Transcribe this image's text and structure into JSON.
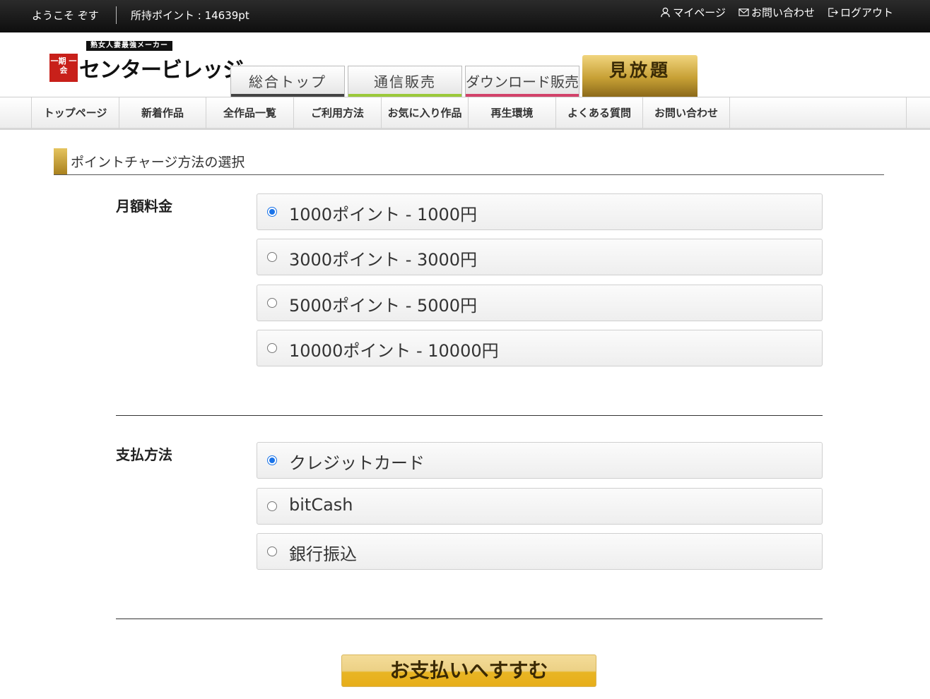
{
  "topbar": {
    "welcome": "ようこそ ぞす",
    "points": "所持ポイント : 14639pt",
    "links": {
      "mypage": "マイページ",
      "contact": "お問い合わせ",
      "logout": "ログアウト"
    }
  },
  "logo": {
    "tagline": "熟女人妻最強メーカー",
    "seal": "一期 一会",
    "name": "センタービレッジ"
  },
  "site_tabs": {
    "top": "総合トップ",
    "tsushin": "通信販売",
    "download": "ダウンロード販売",
    "mihodai": "見放題"
  },
  "site_tab_colors": {
    "top": "#444444",
    "tsushin": "#9bc93a",
    "download": "#d2426a",
    "mihodai": "#c7a035"
  },
  "nav": [
    {
      "label": "トップページ"
    },
    {
      "label": "新着作品"
    },
    {
      "label": "全作品一覧"
    },
    {
      "label": "ご利用方法"
    },
    {
      "label": "お気に入り作品"
    },
    {
      "label": "再生環境"
    },
    {
      "label": "よくある質問"
    },
    {
      "label": "お問い合わせ"
    }
  ],
  "section_title": "ポイントチャージ方法の選択",
  "monthly": {
    "label": "月額料金",
    "options": [
      {
        "label": "1000ポイント - 1000円",
        "selected": true
      },
      {
        "label": "3000ポイント - 3000円",
        "selected": false
      },
      {
        "label": "5000ポイント - 5000円",
        "selected": false
      },
      {
        "label": "10000ポイント - 10000円",
        "selected": false
      }
    ]
  },
  "payment": {
    "label": "支払方法",
    "options": [
      {
        "label": "クレジットカード",
        "selected": true
      },
      {
        "label": "bitCash",
        "selected": false
      },
      {
        "label": "銀行振込",
        "selected": false
      }
    ]
  },
  "submit_label": "お支払いへすすむ"
}
